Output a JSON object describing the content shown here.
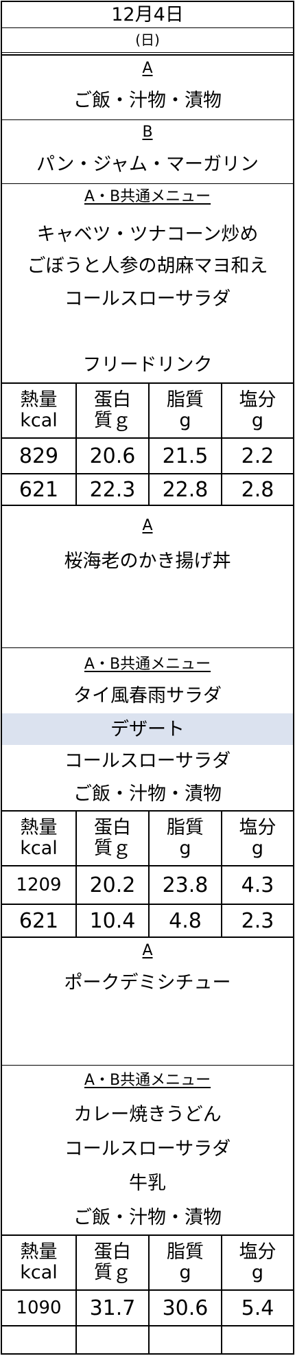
{
  "header": {
    "date": "12月4日",
    "weekday": "(日)"
  },
  "block1": {
    "a_label": "A",
    "a_items": [
      "ご飯・汁物・漬物"
    ],
    "b_label": "B",
    "b_items": [
      "パン・ジャム・マーガリン"
    ],
    "common_label": "A・B共通メニュー",
    "common_items": [
      "キャベツ・ツナコーン炒め",
      "ごぼうと人参の胡麻マヨ和え",
      "コールスローサラダ",
      "",
      "フリードリンク"
    ],
    "nutrition_headers": [
      [
        "熱量",
        "kcal"
      ],
      [
        "蛋白",
        "質ｇ"
      ],
      [
        "脂質",
        "g"
      ],
      [
        "塩分",
        "g"
      ]
    ],
    "nutrition_rows": [
      [
        "829",
        "20.6",
        "21.5",
        "2.2"
      ],
      [
        "621",
        "22.3",
        "22.8",
        "2.8"
      ]
    ]
  },
  "block2": {
    "a_label": "A",
    "a_items": [
      "桜海老のかき揚げ丼"
    ],
    "common_label": "A・B共通メニュー",
    "common_items": [
      "タイ風春雨サラダ",
      "デザート",
      "コールスローサラダ",
      "ご飯・汁物・漬物"
    ],
    "nutrition_headers": [
      [
        "熱量",
        "kcal"
      ],
      [
        "蛋白",
        "質ｇ"
      ],
      [
        "脂質",
        "g"
      ],
      [
        "塩分",
        "g"
      ]
    ],
    "nutrition_rows": [
      [
        "1209",
        "20.2",
        "23.8",
        "4.3"
      ],
      [
        "621",
        "10.4",
        "4.8",
        "2.3"
      ]
    ]
  },
  "block3": {
    "a_label": "A",
    "a_items": [
      "ポークデミシチュー"
    ],
    "common_label": "A・B共通メニュー",
    "common_items": [
      "カレー焼きうどん",
      "コールスローサラダ",
      "牛乳",
      "ご飯・汁物・漬物"
    ],
    "nutrition_headers": [
      [
        "熱量",
        "kcal"
      ],
      [
        "蛋白",
        "質ｇ"
      ],
      [
        "脂質",
        "g"
      ],
      [
        "塩分",
        "g"
      ]
    ],
    "nutrition_rows": [
      [
        "1090",
        "31.7",
        "30.6",
        "5.4"
      ],
      [
        "",
        "",
        "",
        ""
      ]
    ]
  },
  "colors": {
    "highlight": "#dbe2ef",
    "border": "#000000"
  }
}
